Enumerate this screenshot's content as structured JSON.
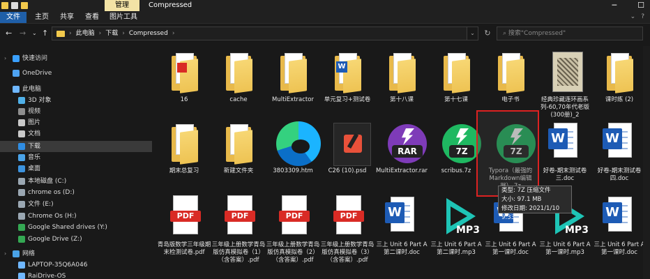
{
  "window": {
    "title": "Compressed",
    "context_tab": "管理",
    "minimize_glyph": "─",
    "maximize_glyph": "☐"
  },
  "ribbon": {
    "tabs": [
      {
        "label": "文件"
      },
      {
        "label": "主页"
      },
      {
        "label": "共享"
      },
      {
        "label": "查看"
      },
      {
        "label": "图片工具"
      }
    ]
  },
  "address": {
    "parts": [
      "此电脑",
      "下载",
      "Compressed"
    ],
    "search_placeholder": "搜索\"Compressed\""
  },
  "sidebar": {
    "items": [
      {
        "label": "快速访问",
        "icon": "star-icon",
        "color": "#3aa0ff"
      },
      {
        "label": "OneDrive",
        "icon": "cloud-icon",
        "color": "#4ea3f2"
      },
      {
        "label": "此电脑",
        "icon": "pc-icon",
        "color": "#6fb7ff"
      },
      {
        "label": "3D 对象",
        "icon": "cube-icon",
        "color": "#4fb0e8"
      },
      {
        "label": "视频",
        "icon": "video-icon",
        "color": "#8e8e8e"
      },
      {
        "label": "图片",
        "icon": "pictures-icon",
        "color": "#c9c9c9"
      },
      {
        "label": "文档",
        "icon": "documents-icon",
        "color": "#c9c9c9"
      },
      {
        "label": "下载",
        "icon": "download-icon",
        "color": "#2f8de3"
      },
      {
        "label": "音乐",
        "icon": "music-icon",
        "color": "#4aa3e8"
      },
      {
        "label": "桌面",
        "icon": "desktop-icon",
        "color": "#3c93de"
      },
      {
        "label": "本地磁盘 (C:)",
        "icon": "drive-icon",
        "color": "#9aa7b2"
      },
      {
        "label": "chrome os (D:)",
        "icon": "drive-icon",
        "color": "#9aa7b2"
      },
      {
        "label": "文件 (E:)",
        "icon": "drive-icon",
        "color": "#9aa7b2"
      },
      {
        "label": "Chrome Os (H:)",
        "icon": "drive-icon",
        "color": "#9aa7b2"
      },
      {
        "label": "Google Shared drives (Y:)",
        "icon": "google-drive-icon",
        "color": "#34a853"
      },
      {
        "label": "Google Drive (Z:)",
        "icon": "google-drive-icon",
        "color": "#34a853"
      },
      {
        "label": "网络",
        "icon": "network-icon",
        "color": "#4aa3e8"
      },
      {
        "label": "LAPTOP-35Q6A046",
        "icon": "computer-icon",
        "color": "#6fb7ff"
      },
      {
        "label": "RaiDrive-OS",
        "icon": "computer-icon",
        "color": "#6fb7ff"
      }
    ]
  },
  "files": [
    {
      "name": "16",
      "type": "pdf-folder"
    },
    {
      "name": "cache",
      "type": "folder-docs"
    },
    {
      "name": "MultiExtractor",
      "type": "folder"
    },
    {
      "name": "单元复习+测试卷",
      "type": "folder-word"
    },
    {
      "name": "第十八课",
      "type": "folder"
    },
    {
      "name": "第十七课",
      "type": "folder"
    },
    {
      "name": "电子书",
      "type": "folder"
    },
    {
      "name": "经典珍藏连环画系列-60,70年代老版(300册)_2",
      "type": "book"
    },
    {
      "name": "课时练 (2)",
      "type": "folder"
    },
    {
      "name": "期末总复习",
      "type": "folder"
    },
    {
      "name": "新建文件夹",
      "type": "folder"
    },
    {
      "name": "3803309.htm",
      "type": "edge"
    },
    {
      "name": "C26 (10).psd",
      "type": "psd"
    },
    {
      "name": "MultiExtractor.rar",
      "type": "rar"
    },
    {
      "name": "scribus.7z",
      "type": "7z"
    },
    {
      "name": "Typora（最强的Markdown编辑器）.7z",
      "type": "7z"
    },
    {
      "name": "好卷-期末测试卷三.doc",
      "type": "word"
    },
    {
      "name": "好卷-期末测试卷四.doc",
      "type": "word"
    },
    {
      "name": "青岛版数学三年级期末检测试卷.pdf",
      "type": "pdf"
    },
    {
      "name": "三年级上册数学青岛版仿真模拟卷（1）（含答案）.pdf",
      "type": "pdf"
    },
    {
      "name": "三年级上册数学青岛版仿真模拟卷（2）（含答案）.pdf",
      "type": "pdf"
    },
    {
      "name": "三年级上册数学青岛版仿真模拟卷（3）（含答案）.pdf",
      "type": "pdf"
    },
    {
      "name": "三上 Unit 6 Part A 第二课时.doc",
      "type": "word"
    },
    {
      "name": "三上 Unit 6 Part A 第二课时.mp3",
      "type": "mp3"
    },
    {
      "name": "三上 Unit 6 Part A 第一课时.doc",
      "type": "word"
    },
    {
      "name": "三上 Unit 6 Part A 第一课时.mp3",
      "type": "mp3"
    },
    {
      "name": "三上 Unit 6 Part A 第一课时.doc",
      "type": "word"
    }
  ],
  "tooltip": {
    "line1": "类型: 7Z 压缩文件",
    "line2": "大小: 97.1 MB",
    "line3": "修改日期: 2021/1/10 9:33"
  },
  "colors": {
    "accent": "#1f5fa8",
    "context_tab": "#f3e3a5",
    "selection_border": "#d22222"
  }
}
